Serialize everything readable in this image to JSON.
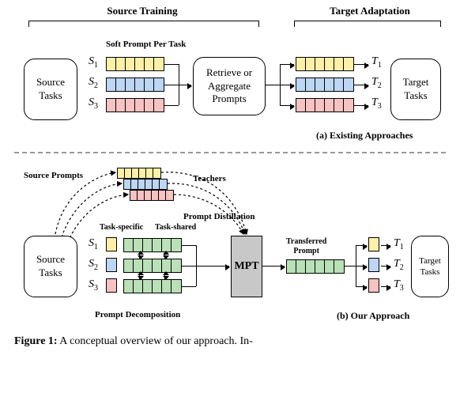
{
  "headers": {
    "source_training": "Source Training",
    "target_adaptation": "Target Adaptation"
  },
  "boxes": {
    "source_tasks": "Source\nTasks",
    "target_tasks": "Target\nTasks",
    "retrieve": "Retrieve or\nAggregate\nPrompts",
    "mpt": "MPT"
  },
  "labels": {
    "soft_prompt_per_task": "Soft Prompt Per Task",
    "source_prompts": "Source Prompts",
    "teachers": "Teachers",
    "prompt_distillation": "Prompt Distillation",
    "task_specific": "Task-specific",
    "task_shared": "Task-shared",
    "transferred_prompt": "Transferred\nPrompt",
    "prompt_decomposition": "Prompt Decomposition",
    "panel_a": "(a) Existing Approaches",
    "panel_b": "(b) Our Approach"
  },
  "tasks": {
    "S1": "S",
    "S1sub": "1",
    "S2": "S",
    "S2sub": "2",
    "S3": "S",
    "S3sub": "3",
    "T1": "T",
    "T1sub": "1",
    "T2": "T",
    "T2sub": "2",
    "T3": "T",
    "T3sub": "3"
  },
  "caption": {
    "lead": "Figure 1:",
    "text": " A conceptual overview of our approach. In-"
  }
}
